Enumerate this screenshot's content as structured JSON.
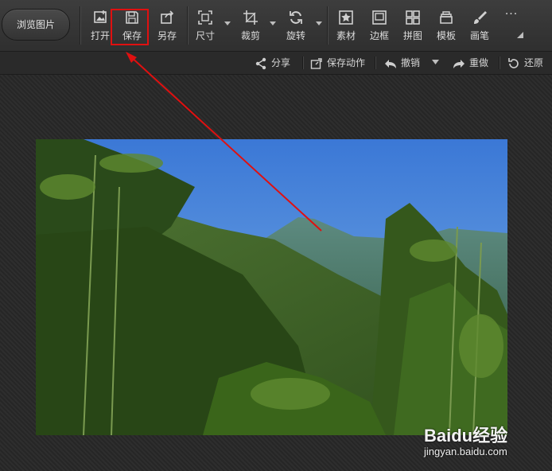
{
  "toolbar": {
    "browse_label": "浏览图片",
    "tools": [
      {
        "label": "打开",
        "icon": "open-image-icon"
      },
      {
        "label": "保存",
        "icon": "save-icon"
      },
      {
        "label": "另存",
        "icon": "save-as-icon"
      },
      {
        "label": "尺寸",
        "icon": "resize-icon"
      },
      {
        "label": "裁剪",
        "icon": "crop-icon"
      },
      {
        "label": "旋转",
        "icon": "rotate-icon"
      },
      {
        "label": "素材",
        "icon": "material-icon"
      },
      {
        "label": "边框",
        "icon": "border-icon"
      },
      {
        "label": "拼图",
        "icon": "collage-icon"
      },
      {
        "label": "模板",
        "icon": "template-icon"
      },
      {
        "label": "画笔",
        "icon": "brush-icon"
      }
    ],
    "more_label": "···"
  },
  "subbar": {
    "share": "分享",
    "save_action": "保存动作",
    "undo": "撤销",
    "redo": "重做",
    "restore": "还原"
  },
  "watermark": {
    "logo": "Baidu经验",
    "url": "jingyan.baidu.com"
  },
  "colors": {
    "highlight": "#e01010",
    "toolbar_bg": "#363636",
    "canvas_bg": "#2b2b2b"
  }
}
